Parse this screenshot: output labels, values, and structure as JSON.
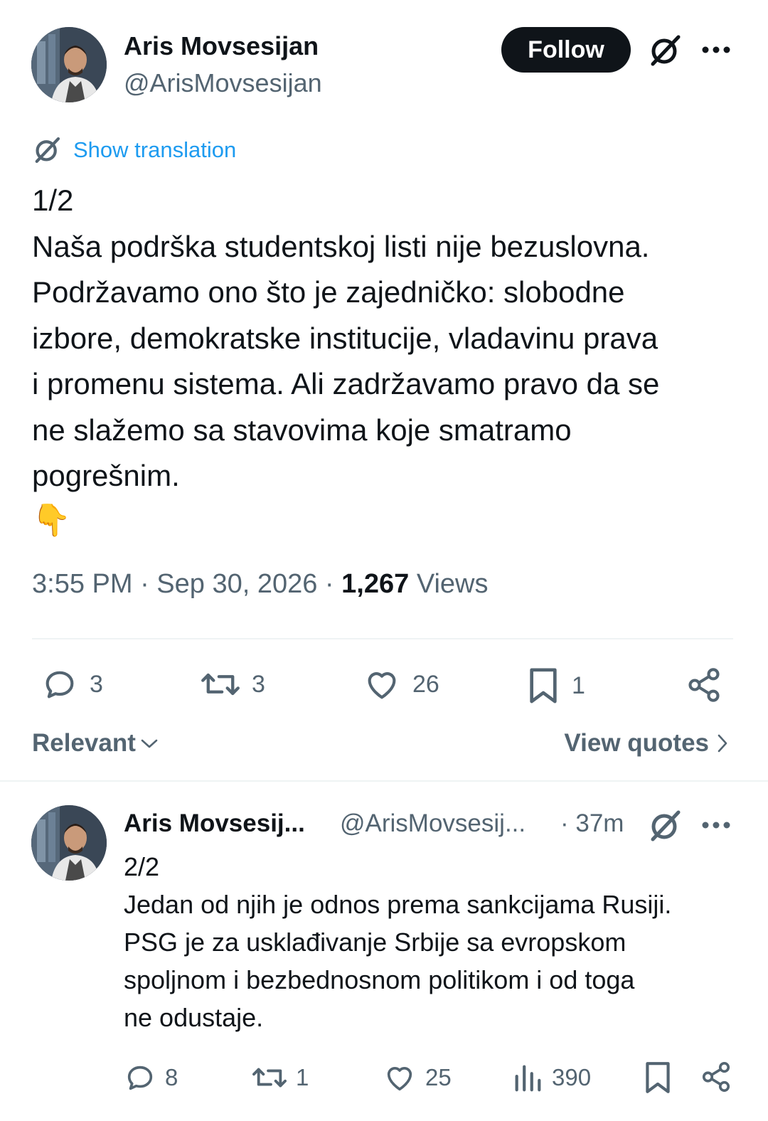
{
  "tweet": {
    "author_name": "Aris Movsesijan",
    "author_handle": "@ArisMovsesijan",
    "follow_label": "Follow",
    "show_translation": "Show translation",
    "lines": [
      "1/2",
      "Naša podrška studentskoj listi nije bezuslovna.",
      "Podržavamo ono što je zajedničko: slobodne",
      "izbore, demokratske institucije, vladavinu prava",
      "i promenu sistema. Ali zadržavamo pravo da se",
      "ne slažemo sa stavovima koje smatramo",
      "pogrešnim."
    ],
    "emoji": "👇",
    "time": "3:55 PM · Sep 30, 2026 ·",
    "views_count": "1,267",
    "views_label": "Views",
    "replies": "3",
    "reposts": "3",
    "likes": "26",
    "bookmarks": "1"
  },
  "sort": {
    "label": "Relevant",
    "view_quotes": "View quotes"
  },
  "reply": {
    "author_name": "Aris Movsesij...",
    "author_handle": "@ArisMovsesij...",
    "time": "· 37m",
    "lines": [
      "2/2",
      "Jedan od njih je odnos prema sankcijama Rusiji.",
      "PSG je za usklađivanje Srbije sa evropskom",
      "spoljnom i bezbednosnom politikom i od toga",
      "ne odustaje."
    ],
    "replies": "8",
    "reposts": "1",
    "likes": "25",
    "views": "390"
  },
  "colors": {
    "text": "#0f1419",
    "secondary": "#536471",
    "link": "#1d9bf0",
    "divider": "#eff3f4"
  }
}
